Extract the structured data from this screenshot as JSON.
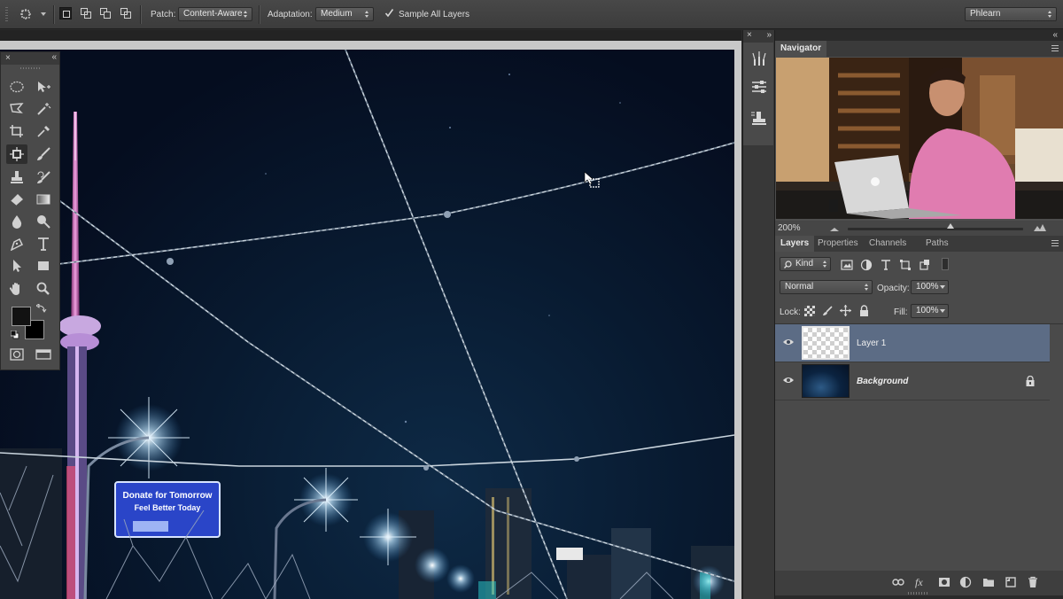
{
  "options_bar": {
    "patch_label": "Patch:",
    "patch_value": "Content-Aware",
    "adaptation_label": "Adaptation:",
    "adaptation_value": "Medium",
    "sample_all_layers_label": "Sample All Layers",
    "sample_all_layers_checked": true,
    "workspace_value": "Phlearn"
  },
  "tools_panel": {
    "close_glyph": "×",
    "collapse_glyph": "«",
    "tools": [
      {
        "name": "elliptical-marquee-icon"
      },
      {
        "name": "move-icon"
      },
      {
        "name": "polygonal-lasso-icon"
      },
      {
        "name": "magic-wand-icon"
      },
      {
        "name": "crop-icon"
      },
      {
        "name": "eyedropper-icon"
      },
      {
        "name": "patch-tool-icon",
        "active": true
      },
      {
        "name": "brush-icon"
      },
      {
        "name": "clone-stamp-icon"
      },
      {
        "name": "history-brush-icon"
      },
      {
        "name": "eraser-icon"
      },
      {
        "name": "gradient-icon"
      },
      {
        "name": "blur-icon"
      },
      {
        "name": "dodge-icon"
      },
      {
        "name": "pen-icon"
      },
      {
        "name": "type-icon"
      },
      {
        "name": "path-selection-icon"
      },
      {
        "name": "rectangle-shape-icon"
      },
      {
        "name": "hand-icon"
      },
      {
        "name": "zoom-icon"
      }
    ],
    "foreground_color": "#121212",
    "background_color": "#000000"
  },
  "navigator": {
    "tab_label": "Navigator",
    "zoom": "200%"
  },
  "layers_panel": {
    "tabs": [
      "Layers",
      "Properties",
      "Channels",
      "Paths"
    ],
    "filter_label": "Kind",
    "blend_mode": "Normal",
    "opacity_label": "Opacity:",
    "opacity_value": "100%",
    "lock_label": "Lock:",
    "fill_label": "Fill:",
    "fill_value": "100%",
    "layers": [
      {
        "name": "Layer 1",
        "selected": true,
        "visible": true,
        "locked": false
      },
      {
        "name": "Background",
        "selected": false,
        "visible": true,
        "locked": true
      }
    ]
  },
  "document": {
    "billboard_line1": "Donate for Tomorrow",
    "billboard_line2": "Feel Better Today"
  },
  "colors": {
    "selected_layer": "#5c6c85",
    "panel_bg": "#4a4a4a",
    "sky": "#050d1f"
  }
}
